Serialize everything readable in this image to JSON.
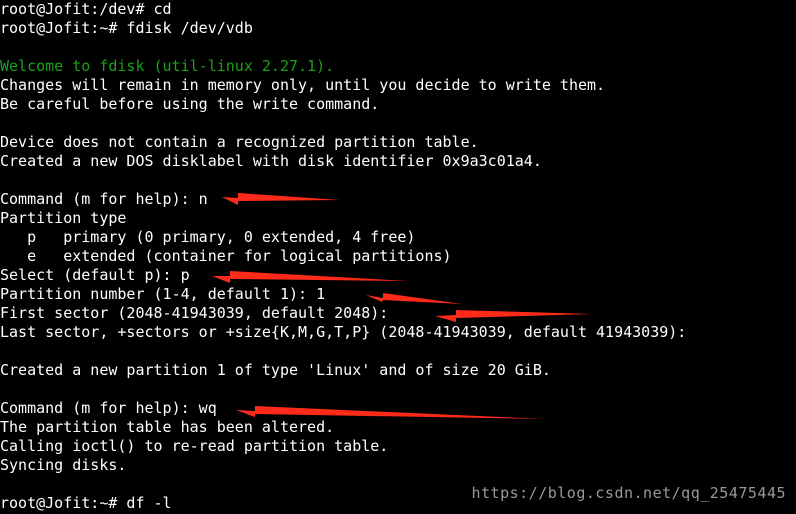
{
  "terminal": {
    "lines": [
      "root@Jofit:/dev# cd",
      "root@Jofit:~# fdisk /dev/vdb",
      "",
      "Welcome to fdisk (util-linux 2.27.1).",
      "Changes will remain in memory only, until you decide to write them.",
      "Be careful before using the write command.",
      "",
      "Device does not contain a recognized partition table.",
      "Created a new DOS disklabel with disk identifier 0x9a3c01a4.",
      "",
      "Command (m for help): n",
      "Partition type",
      "   p   primary (0 primary, 0 extended, 4 free)",
      "   e   extended (container for logical partitions)",
      "Select (default p): p",
      "Partition number (1-4, default 1): 1",
      "First sector (2048-41943039, default 2048):",
      "Last sector, +sectors or +size{K,M,G,T,P} (2048-41943039, default 41943039):",
      "",
      "Created a new partition 1 of type 'Linux' and of size 20 GiB.",
      "",
      "Command (m for help): wq",
      "The partition table has been altered.",
      "Calling ioctl() to re-read partition table.",
      "Syncing disks.",
      "",
      "root@Jofit:~# df -l"
    ]
  },
  "watermark": "https://blog.csdn.net/qq_25475445",
  "colors": {
    "background": "#000000",
    "text": "#ffffff",
    "welcome": "#1aa11a",
    "arrow": "#ff2a1a",
    "watermark": "#9a9a9a"
  }
}
